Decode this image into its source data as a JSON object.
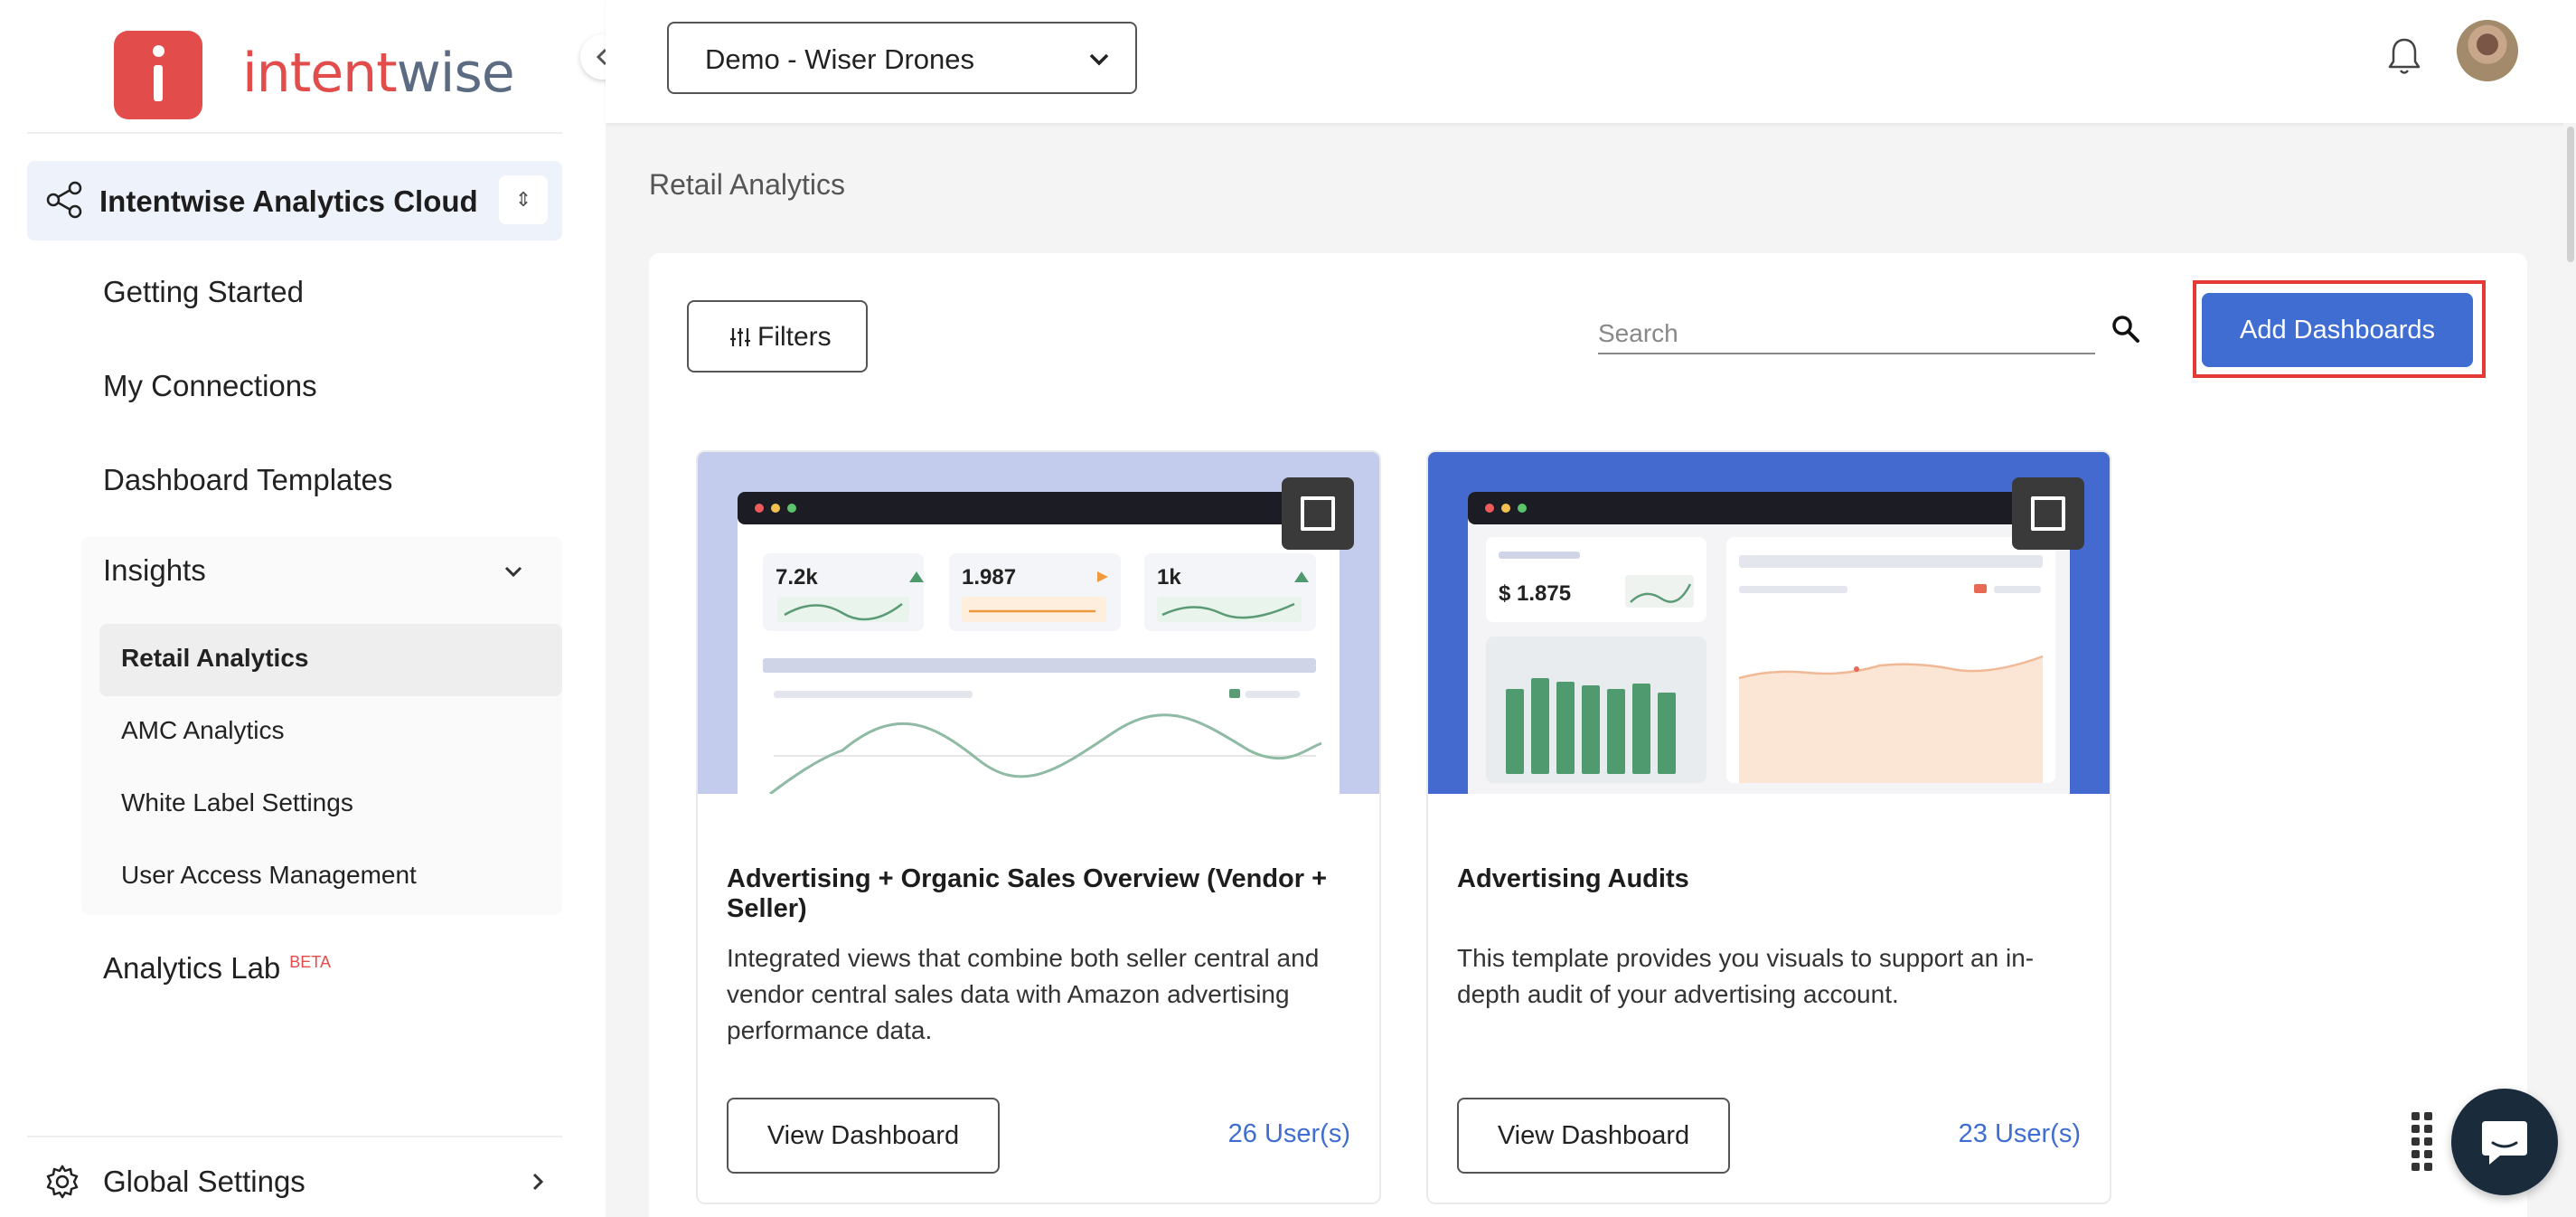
{
  "brand": {
    "logo_part1": "intent",
    "logo_part2": "wise"
  },
  "sidebar": {
    "workspace_label": "Intentwise Analytics Cloud",
    "items": [
      {
        "label": "Getting Started"
      },
      {
        "label": "My Connections"
      },
      {
        "label": "Dashboard Templates"
      }
    ],
    "insights": {
      "label": "Insights",
      "sub_items": [
        {
          "label": "Retail Analytics",
          "active": true
        },
        {
          "label": "AMC Analytics"
        },
        {
          "label": "White Label Settings"
        },
        {
          "label": "User Access Management"
        }
      ]
    },
    "analytics_lab": {
      "label": "Analytics Lab",
      "badge": "BETA"
    },
    "global_settings": {
      "label": "Global Settings"
    }
  },
  "topbar": {
    "org_select_value": "Demo - Wiser Drones"
  },
  "main": {
    "page_title": "Retail Analytics",
    "filters_label": "Filters",
    "search_placeholder": "Search",
    "add_button_label": "Add Dashboards",
    "cards": [
      {
        "title": "Advertising + Organic Sales Overview (Vendor + Seller)",
        "description": "Integrated views that combine both seller central and vendor central sales data with Amazon advertising performance data.",
        "button_label": "View Dashboard",
        "users": "26 User(s)",
        "preview": {
          "kpi_1": "7.2k",
          "kpi_2": "1.987",
          "kpi_3": "1k"
        }
      },
      {
        "title": "Advertising Audits",
        "description": "This template provides you visuals to support an in-depth audit of your advertising account.",
        "button_label": "View Dashboard",
        "users": "23 User(s)",
        "preview": {
          "kpi_1": "$ 1.875"
        }
      }
    ]
  },
  "colors": {
    "brand_red": "#e24c4b",
    "primary_blue": "#3f6dd1",
    "highlight_red": "#e53935"
  }
}
